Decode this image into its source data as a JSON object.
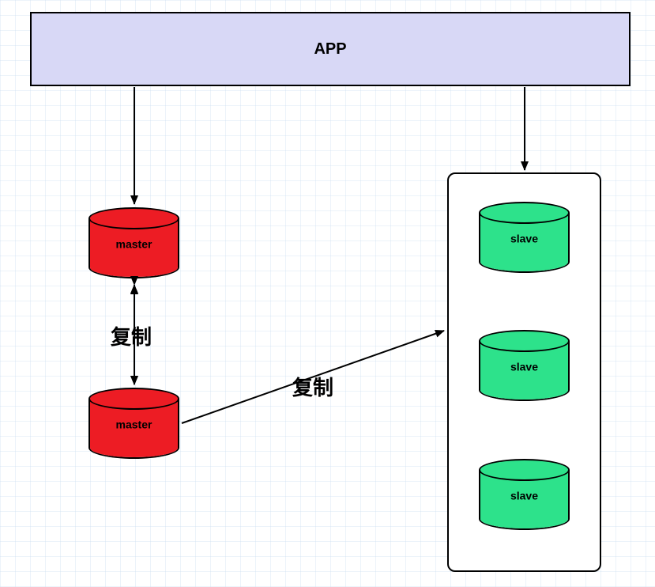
{
  "app": {
    "title": "APP"
  },
  "masters": [
    {
      "label": "master"
    },
    {
      "label": "master"
    }
  ],
  "slaves": [
    {
      "label": "slave"
    },
    {
      "label": "slave"
    },
    {
      "label": "slave"
    }
  ],
  "edges": {
    "replicate_vertical": "复制",
    "replicate_diagonal": "复制"
  },
  "colors": {
    "app_bg": "#d8d8f6",
    "master_fill": "#ed1c24",
    "slave_fill": "#2de28b",
    "stroke": "#000000"
  }
}
